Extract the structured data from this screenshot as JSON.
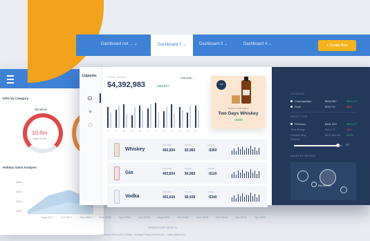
{
  "left_panel": {
    "kpi_title": "KPIs by Category",
    "category": "Wineless",
    "gauge_value": "10.6m",
    "gauge_sub": "Target 15.0m",
    "section_title": "Holiday Sales Analysis",
    "y_ticks": [
      "$6m",
      "$5m",
      "$4m",
      "$3m",
      "$2m",
      "$1m",
      "$0m"
    ],
    "x_ticks": [
      "Aug 2017",
      "Oct 2017",
      "Dec 2017",
      "Feb 2018",
      "Apr 2018",
      "Jun 2018",
      "Aug 2018",
      "Oct 2018",
      "Dec 2018",
      "Feb 2019",
      "Apr 2019",
      "Jun 2019"
    ],
    "x_title": "ORDER DATE MONTH",
    "footer": "○ Holiday Period (2017/2018) ○ Holiday Period (2018/2019) ○ Sales (Metrics $)"
  },
  "topbar": {
    "tabs": [
      {
        "label": "Dashboard not ...",
        "active": false
      },
      {
        "label": "Dashboard 2",
        "active": true
      },
      {
        "label": "Dashboard 3",
        "active": false
      },
      {
        "label": "Dashboard 4",
        "active": false
      }
    ],
    "create_label": "+ Create New"
  },
  "dashboard": {
    "logo": "Liquorio.",
    "total_label": "TOTAL SALES",
    "total_value": "$4,392,983",
    "total_delta": "↑$23,877",
    "period": "Last year",
    "month_letters": [
      "J",
      "F",
      "M",
      "A",
      "M",
      "J",
      "J",
      "A",
      "S",
      "O",
      "N",
      "D"
    ],
    "promo": {
      "badge": "TOP SELLER",
      "eyebrow": "TODAY'S TOP SHELF",
      "name": "Two Days Whiskey",
      "price": "↑$320"
    },
    "products": [
      {
        "name": "Whiskey",
        "volume_label": "VOLUME",
        "volume": "492,834",
        "value_label": "VALUE",
        "value": "$3,983",
        "sales_label": "SALES",
        "sales": "↑$360"
      },
      {
        "name": "Gin",
        "volume_label": "VOLUME",
        "volume": "492,834",
        "value_label": "VALUE",
        "value": "$4,983",
        "sales_label": "SALES",
        "sales": "↑$120"
      },
      {
        "name": "Vodka",
        "volume_label": "VOLUME",
        "volume": "492,834",
        "value_label": "VALUE",
        "value": "$9,938",
        "sales_label": "SALES",
        "sales": "↑$340"
      }
    ],
    "right": {
      "location_label": "LOCATION",
      "locations": [
        {
          "name": "Cosmopolitan",
          "value": "$634,987",
          "delta": "↑$20,477"
        },
        {
          "name": "Rock",
          "value": "$78,773",
          "delta": "↓$90"
        }
      ],
      "sales_type_label": "SALES TYPE",
      "sales_types": [
        {
          "name": "Premium",
          "value": "$161,223",
          "delta": "↑$20,477"
        },
        {
          "name": "Total Range",
          "value": "$78,773",
          "delta": "↓$60"
        },
        {
          "name": "Lifestyle Buy",
          "value": "$101,884.55",
          "delta": "↑$100"
        }
      ],
      "slider_label": "RANGE",
      "slider_value": "31°",
      "map_label": "SALES BY REGION",
      "map_city": "Des Moines"
    }
  }
}
